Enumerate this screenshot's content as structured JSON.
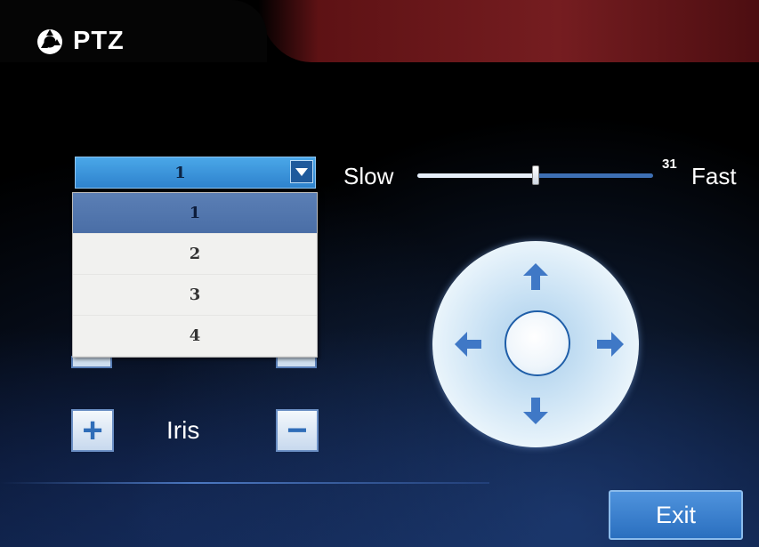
{
  "header": {
    "title": "PTZ",
    "icon": "ptz-logo-icon"
  },
  "preset": {
    "selected_value": "1",
    "options": [
      "1",
      "2",
      "3",
      "4"
    ],
    "highlighted_index": 0
  },
  "speed": {
    "slow_label": "Slow",
    "fast_label": "Fast",
    "value": "31",
    "level_fraction": 0.5
  },
  "iris": {
    "label": "Iris",
    "plus_symbol": "+",
    "minus_symbol": "−"
  },
  "dpad": {
    "icons": [
      "arrow-up-icon",
      "arrow-down-icon",
      "arrow-left-icon",
      "arrow-right-icon"
    ]
  },
  "footer": {
    "exit_label": "Exit"
  },
  "colors": {
    "accent": "#2e82cd",
    "button_blue": "#3a7fcf",
    "background": "#000000"
  }
}
